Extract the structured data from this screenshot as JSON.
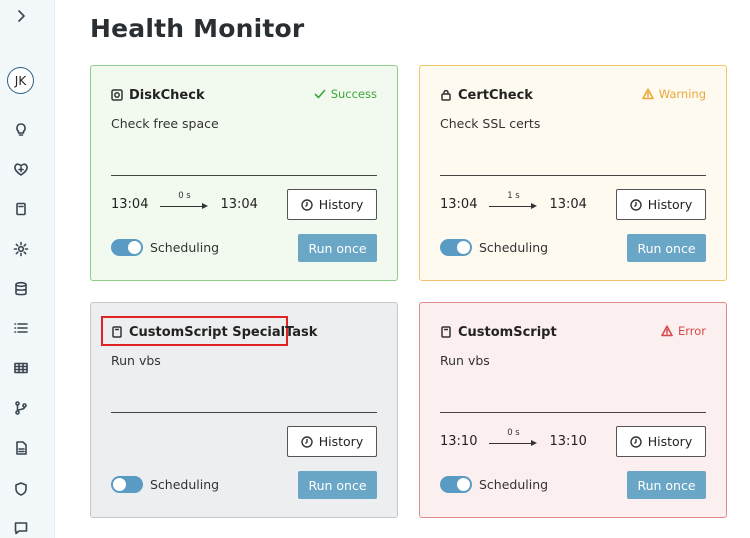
{
  "page": {
    "title": "Health Monitor"
  },
  "sidebar": {
    "user_initials": "JK"
  },
  "cards": [
    {
      "name": "DiskCheck",
      "type_icon": "disk-icon",
      "status": "Success",
      "status_color": "#3aa63a",
      "description": "Check free space",
      "start_time": "13:04",
      "duration": "0 s",
      "end_time": "13:04",
      "history_label": "History",
      "scheduling_label": "Scheduling",
      "scheduling_enabled": true,
      "run_label": "Run once"
    },
    {
      "name": "CertCheck",
      "type_icon": "lock-icon",
      "status": "Warning",
      "status_color": "#e8a93a",
      "description": "Check SSL certs",
      "start_time": "13:04",
      "duration": "1 s",
      "end_time": "13:04",
      "history_label": "History",
      "scheduling_label": "Scheduling",
      "scheduling_enabled": true,
      "run_label": "Run once"
    },
    {
      "name": "CustomScript SpecialTask",
      "type_icon": "script-icon",
      "status": "",
      "description": "Run vbs",
      "history_label": "History",
      "scheduling_label": "Scheduling",
      "scheduling_enabled": false,
      "run_label": "Run once"
    },
    {
      "name": "CustomScript",
      "type_icon": "script-icon",
      "status": "Error",
      "status_color": "#d84a4a",
      "description": "Run vbs",
      "start_time": "13:10",
      "duration": "0 s",
      "end_time": "13:10",
      "history_label": "History",
      "scheduling_label": "Scheduling",
      "scheduling_enabled": true,
      "run_label": "Run once"
    }
  ]
}
